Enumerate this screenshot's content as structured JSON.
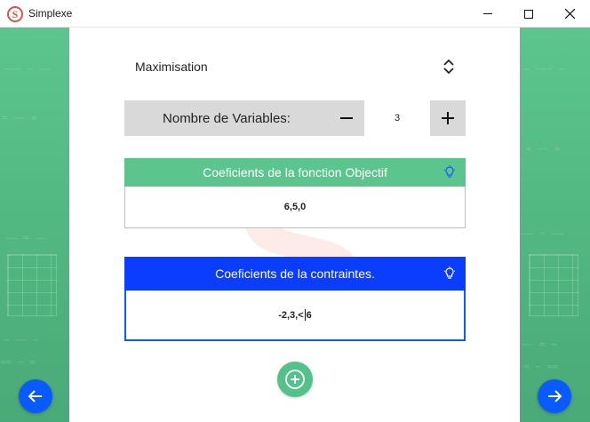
{
  "window": {
    "title": "Simplexe",
    "app_icon_letter": "S",
    "minimize_icon": "minimize-icon",
    "maximize_icon": "maximize-icon",
    "close_icon": "close-icon"
  },
  "optimization": {
    "selected": "Maximisation",
    "icon": "chevron-up-down-icon"
  },
  "variables": {
    "label": "Nombre de Variables:",
    "value": "3",
    "decrement_icon": "minus-icon",
    "increment_icon": "plus-icon"
  },
  "objective": {
    "header": "Coeficients de la fonction Objectif",
    "value": "6,5,0",
    "hint_icon": "lightbulb-icon",
    "header_color": "#5cc58d"
  },
  "constraints": {
    "header": "Coeficients de la contraintes.",
    "value_before_caret": "-2,3,<",
    "value_after_caret": "6",
    "hint_icon": "lightbulb-icon",
    "header_color": "#0a3dff"
  },
  "actions": {
    "add_icon": "plus-circle-icon",
    "prev_icon": "arrow-left-icon",
    "next_icon": "arrow-right-icon"
  },
  "colors": {
    "accent_green": "#5cc58d",
    "accent_blue": "#0a5bff",
    "watermark": "#f06e64"
  }
}
